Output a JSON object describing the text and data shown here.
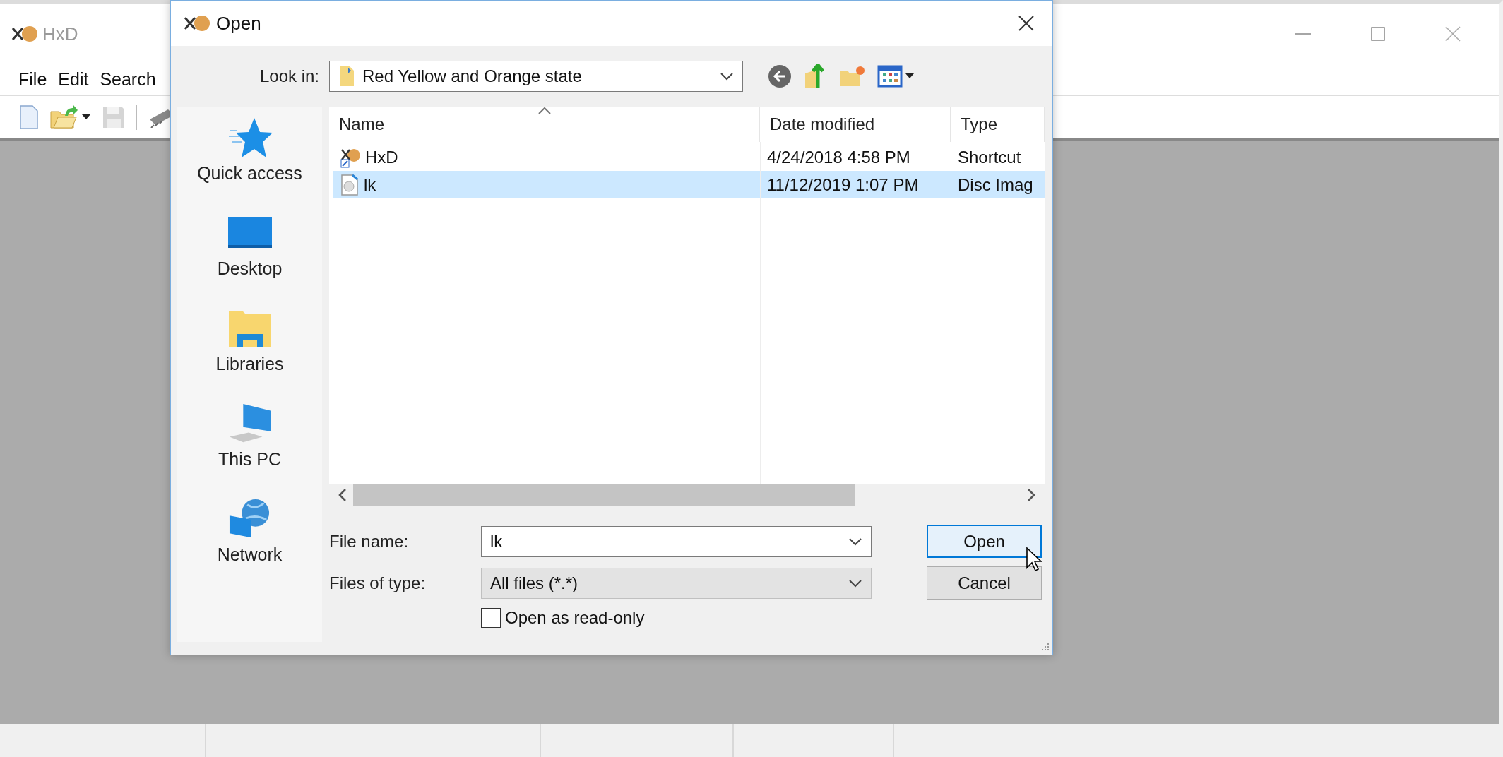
{
  "main_window": {
    "title": "HxD",
    "menu": [
      {
        "label": "File"
      },
      {
        "label": "Edit"
      },
      {
        "label": "Search"
      }
    ],
    "toolbar": [
      {
        "kind": "new"
      },
      {
        "kind": "open",
        "disabled": false
      },
      {
        "kind": "save",
        "disabled": true
      },
      {
        "kind": "chip",
        "disabled": false
      }
    ]
  },
  "dialog": {
    "title": "Open",
    "look_in": {
      "label": "Look in:",
      "value": "Red Yellow and Orange state"
    },
    "places": [
      {
        "label": "Quick access",
        "kind": "star"
      },
      {
        "label": "Desktop",
        "kind": "desktop"
      },
      {
        "label": "Libraries",
        "kind": "libraries"
      },
      {
        "label": "This PC",
        "kind": "pc"
      },
      {
        "label": "Network",
        "kind": "network"
      }
    ],
    "columns": [
      "Name",
      "Date modified",
      "Type"
    ],
    "rows": [
      {
        "name": "HxD",
        "date": "4/24/2018 4:58 PM",
        "type": "Shortcut",
        "kind": "shortcut",
        "selected": false
      },
      {
        "name": "lk",
        "date": "11/12/2019 1:07 PM",
        "type": "Disc Imag",
        "kind": "disc",
        "selected": true
      }
    ],
    "file_name": {
      "label": "File name:",
      "value": "lk"
    },
    "file_type": {
      "label": "Files of type:",
      "value": "All files (*.*)"
    },
    "read_only": {
      "label": "Open as read-only",
      "checked": false
    },
    "buttons": [
      {
        "label": "Open",
        "default": true
      },
      {
        "label": "Cancel",
        "default": false
      }
    ]
  }
}
